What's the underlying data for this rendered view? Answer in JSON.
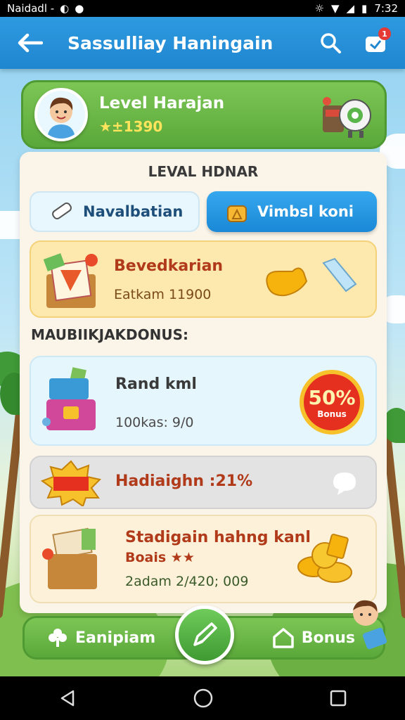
{
  "status_bar": {
    "carrier": "Naidadl -",
    "time": "7:32"
  },
  "app_bar": {
    "title": "Sassulliay Haningain",
    "notification_count": "1"
  },
  "profile": {
    "name": "Level Harajan",
    "score": "★±1390"
  },
  "panel": {
    "title": "LEVAL HDNAR",
    "tabs": [
      {
        "label": "Navalbatian",
        "icon": "tag-icon"
      },
      {
        "label": "Vimbsl koni",
        "icon": "bag-icon"
      }
    ]
  },
  "cards": {
    "featured": {
      "title": "Bevedkarian",
      "sub": "Eatkam 11900"
    },
    "section_label": "MAUBIIKJAKDONUS:",
    "rand": {
      "title": "Rand kml",
      "sub": "100kas: 9/0",
      "badge_percent": "50%",
      "badge_label": "Bonus"
    },
    "hadiaighn": {
      "title": "Hadiaighn :21%"
    },
    "stadigain": {
      "title": "Stadigain hahng kanl",
      "sub_title": "Boais ★★",
      "sub": "2adam 2/420; 009"
    }
  },
  "action_bar": {
    "left_label": "Eanipiam",
    "right_label": "Bonus"
  },
  "colors": {
    "primary": "#1f86d0",
    "green": "#5aa83a",
    "accent_red": "#e53020",
    "gold": "#f6c12a"
  }
}
